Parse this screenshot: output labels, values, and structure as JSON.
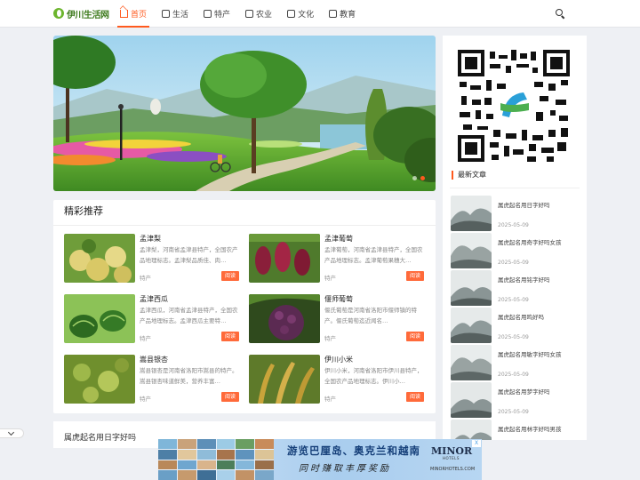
{
  "site": {
    "logo_text": "伊川生活网"
  },
  "nav": {
    "items": [
      {
        "label": "首页",
        "icon": "home-icon",
        "active": true
      },
      {
        "label": "生活",
        "icon": "category-icon"
      },
      {
        "label": "特产",
        "icon": "category-icon"
      },
      {
        "label": "农业",
        "icon": "category-icon"
      },
      {
        "label": "文化",
        "icon": "category-icon"
      },
      {
        "label": "教育",
        "icon": "category-icon"
      }
    ],
    "search_icon": "search-icon"
  },
  "slider": {
    "slides": 2,
    "active_slide": 2,
    "accent": "#ff5a1e"
  },
  "featured": {
    "title": "精彩推荐",
    "read_label": "阅读",
    "items": [
      {
        "title": "孟津梨",
        "desc": "孟津梨，河南省孟津县特产，全国农产品地理标志。孟津梨品质佳、肉…",
        "category": "特产",
        "image": "pear-photo"
      },
      {
        "title": "孟津葡萄",
        "desc": "孟津葡萄，河南省孟津县特产，全国农产品地理标志。孟津葡萄果穗大…",
        "category": "特产",
        "image": "grape-photo"
      },
      {
        "title": "孟津西瓜",
        "desc": "孟津西瓜，河南省孟津县特产，全国农产品地理标志。孟津西瓜主要特…",
        "category": "特产",
        "image": "watermelon-photo"
      },
      {
        "title": "偃师葡萄",
        "desc": "偃氏葡萄是河南省洛阳市偃师镇的特产。偃氏葡萄迄近闻名…",
        "category": "特产",
        "image": "grape-photo-2"
      },
      {
        "title": "嵩县银杏",
        "desc": "嵩县银杏是河南省洛阳市嵩县的特产。嵩县银杏味道鲜美，营养丰富…",
        "category": "特产",
        "image": "ginkgo-photo"
      },
      {
        "title": "伊川小米",
        "desc": "伊川小米，河南省洛阳市伊川县特产，全国农产品地理标志。伊川小…",
        "category": "特产",
        "image": "millet-photo"
      }
    ]
  },
  "sidebar": {
    "qr_code": "qr-code",
    "latest_title": "最新文章",
    "articles": [
      {
        "title": "属虎起名用日字好吗",
        "date": "2025-05-09"
      },
      {
        "title": "属虎起名用奇字好吗女孩",
        "date": "2025-05-09"
      },
      {
        "title": "属虎起名用铭字好吗",
        "date": "2025-05-09"
      },
      {
        "title": "属虎起名用鸣好吗",
        "date": "2025-05-09"
      },
      {
        "title": "属虎起名用敏字好吗女孩",
        "date": "2025-05-09"
      },
      {
        "title": "属虎起名用梦字好吗",
        "date": "2025-05-09"
      },
      {
        "title": "属虎起名用林字好吗男孩",
        "date": ""
      }
    ]
  },
  "list2": {
    "first_title": "属虎起名用日字好吗"
  },
  "ad": {
    "headline": "游览巴厘岛、奥克兰和越南",
    "subline": "同时赚取丰厚奖励",
    "brand": "MINOR",
    "brand_sub": "HOTELS",
    "url": "MINORHOTELS.COM",
    "close_label": "X"
  },
  "colors": {
    "accent": "#ff5a1e",
    "read_button": "#ff6a3a",
    "background": "#eef0f4"
  }
}
